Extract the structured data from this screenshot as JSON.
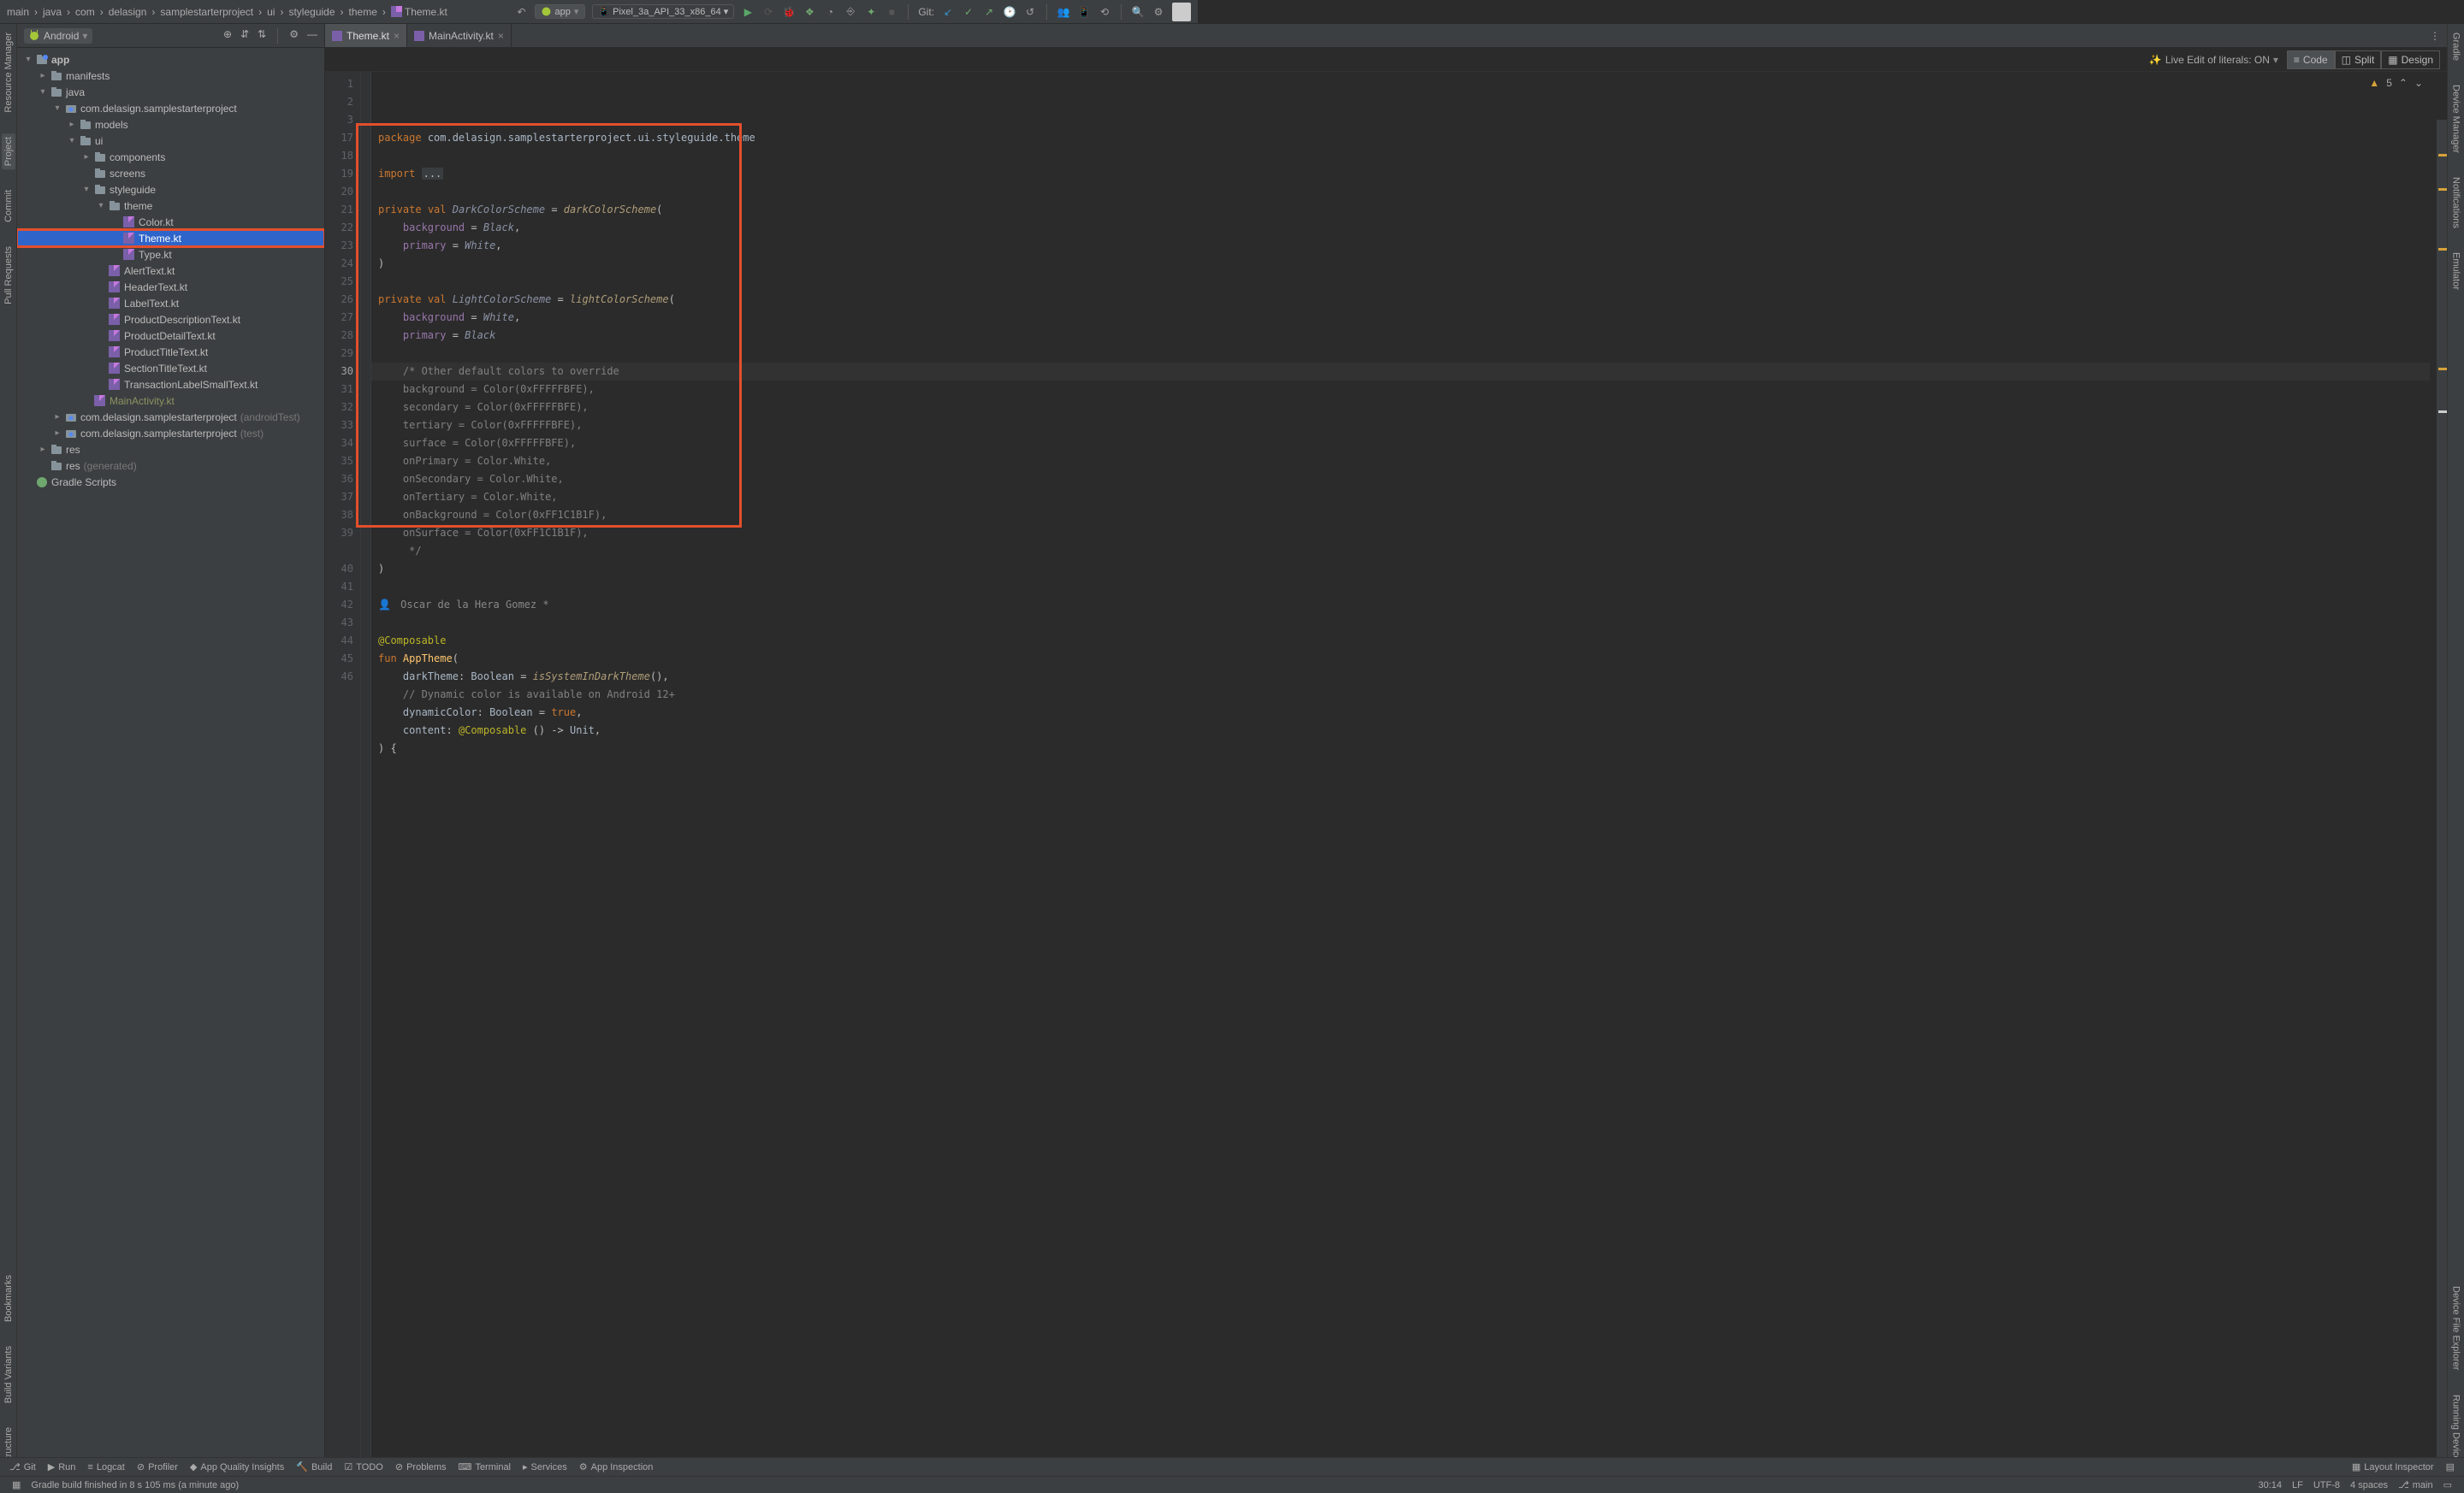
{
  "breadcrumb": [
    "main",
    "java",
    "com",
    "delasign",
    "samplestarterproject",
    "ui",
    "styleguide",
    "theme",
    "Theme.kt"
  ],
  "runConfig": "app",
  "deviceConfig": "Pixel_3a_API_33_x86_64 ▾",
  "gitLabel": "Git:",
  "sidebar": {
    "title": "Android",
    "items": [
      {
        "d": 0,
        "a": "down",
        "ico": "mod",
        "t": "app",
        "bold": true
      },
      {
        "d": 1,
        "a": "right",
        "ico": "fld",
        "t": "manifests"
      },
      {
        "d": 1,
        "a": "down",
        "ico": "fld",
        "t": "java"
      },
      {
        "d": 2,
        "a": "down",
        "ico": "pkg",
        "t": "com.delasign.samplestarterproject"
      },
      {
        "d": 3,
        "a": "right",
        "ico": "fld",
        "t": "models"
      },
      {
        "d": 3,
        "a": "down",
        "ico": "fld",
        "t": "ui"
      },
      {
        "d": 4,
        "a": "right",
        "ico": "fld",
        "t": "components"
      },
      {
        "d": 4,
        "a": "",
        "ico": "fld",
        "t": "screens"
      },
      {
        "d": 4,
        "a": "down",
        "ico": "fld",
        "t": "styleguide"
      },
      {
        "d": 5,
        "a": "down",
        "ico": "fld",
        "t": "theme"
      },
      {
        "d": 6,
        "a": "",
        "ico": "kt",
        "t": "Color.kt"
      },
      {
        "d": 6,
        "a": "",
        "ico": "kt",
        "t": "Theme.kt",
        "sel": true
      },
      {
        "d": 6,
        "a": "",
        "ico": "kt",
        "t": "Type.kt"
      },
      {
        "d": 5,
        "a": "",
        "ico": "kt",
        "t": "AlertText.kt"
      },
      {
        "d": 5,
        "a": "",
        "ico": "kt",
        "t": "HeaderText.kt"
      },
      {
        "d": 5,
        "a": "",
        "ico": "kt",
        "t": "LabelText.kt"
      },
      {
        "d": 5,
        "a": "",
        "ico": "kt",
        "t": "ProductDescriptionText.kt"
      },
      {
        "d": 5,
        "a": "",
        "ico": "kt",
        "t": "ProductDetailText.kt"
      },
      {
        "d": 5,
        "a": "",
        "ico": "kt",
        "t": "ProductTitleText.kt"
      },
      {
        "d": 5,
        "a": "",
        "ico": "kt",
        "t": "SectionTitleText.kt"
      },
      {
        "d": 5,
        "a": "",
        "ico": "kt",
        "t": "TransactionLabelSmallText.kt"
      },
      {
        "d": 4,
        "a": "",
        "ico": "kt",
        "t": "MainActivity.kt",
        "olive": true
      },
      {
        "d": 2,
        "a": "right",
        "ico": "pkg",
        "t": "com.delasign.samplestarterproject",
        "suffix": "(androidTest)"
      },
      {
        "d": 2,
        "a": "right",
        "ico": "pkg",
        "t": "com.delasign.samplestarterproject",
        "suffix": "(test)"
      },
      {
        "d": 1,
        "a": "right",
        "ico": "fld",
        "t": "res"
      },
      {
        "d": 1,
        "a": "",
        "ico": "fld",
        "t": "res",
        "suffix": "(generated)"
      },
      {
        "d": 0,
        "a": "",
        "ico": "grd",
        "t": "Gradle Scripts"
      }
    ]
  },
  "tabs": [
    {
      "label": "Theme.kt",
      "active": true
    },
    {
      "label": "MainActivity.kt",
      "active": false
    }
  ],
  "liveEdit": "Live Edit of literals: ON",
  "modes": {
    "code": "Code",
    "split": "Split",
    "design": "Design"
  },
  "warnCount": "5",
  "gutterNums": [
    "1",
    "2",
    "3",
    "17",
    "18",
    "19",
    "20",
    "21",
    "22",
    "23",
    "24",
    "25",
    "26",
    "27",
    "28",
    "29",
    "30",
    "31",
    "32",
    "33",
    "34",
    "35",
    "36",
    "37",
    "38",
    "39",
    "",
    "40",
    "41",
    "42",
    "43",
    "44",
    "45",
    "46"
  ],
  "code": {
    "pkg_kw": "package",
    "pkg_val": "com.delasign.samplestarterproject.ui.styleguide.theme",
    "imp_kw": "import",
    "imp_dots": "...",
    "priv": "private",
    "valkw": "val",
    "dcs": "DarkColorScheme",
    "eq": " = ",
    "dcall": "darkColorScheme",
    "op": "(",
    "bg": "background",
    "eq2": " = ",
    "black": "Black",
    "comma": ",",
    "pri": "primary",
    "white": "White",
    "cp": ")",
    "lcs": "LightColorScheme",
    "lcall": "lightColorScheme",
    "cmt1": "/* Other default colors to override",
    "cmt2": "background = Color(0xFFFFFBFE),",
    "cmt3": "secondary = Color(0xFFFFFBFE),",
    "cmt4": "tertiary = Color(0xFFFFFBFE),",
    "cmt5": "surface = Color(0xFFFFFBFE),",
    "cmt6": "onPrimary = Color.White,",
    "cmt7": "onSecondary = Color.White,",
    "cmt8": "onTertiary = Color.White,",
    "cmt9": "onBackground = Color(0xFF1C1B1F),",
    "cmt10": "onSurface = Color(0xFF1C1B1F),",
    "cmt11": " */",
    "author": "Oscar de la Hera Gomez *",
    "comp": "@Composable",
    "fun": "fun",
    "apptheme": "AppTheme",
    "dk": "darkTheme",
    "bool": "Boolean",
    "isdrk": "isSystemInDarkTheme",
    "dcom": "// Dynamic color is available on Android 12+",
    "dyn": "dynamicColor",
    "tru": "true",
    "cont": "content",
    "unit": "Unit"
  },
  "leftTabs": [
    "Resource Manager",
    "Project",
    "Commit",
    "Pull Requests",
    "Bookmarks",
    "Build Variants",
    "Structure"
  ],
  "rightTabs": [
    "Gradle",
    "Device Manager",
    "Notifications",
    "Emulator",
    "Device File Explorer",
    "Running Devices"
  ],
  "toolstrip": {
    "git": "Git",
    "run": "Run",
    "logcat": "Logcat",
    "profiler": "Profiler",
    "aqi": "App Quality Insights",
    "build": "Build",
    "todo": "TODO",
    "problems": "Problems",
    "terminal": "Terminal",
    "services": "Services",
    "appinsp": "App Inspection",
    "layoutinsp": "Layout Inspector"
  },
  "status": {
    "msg": "Gradle build finished in 8 s 105 ms (a minute ago)",
    "pos": "30:14",
    "lf": "LF",
    "enc": "UTF-8",
    "indent": "4 spaces",
    "branch": "main"
  }
}
